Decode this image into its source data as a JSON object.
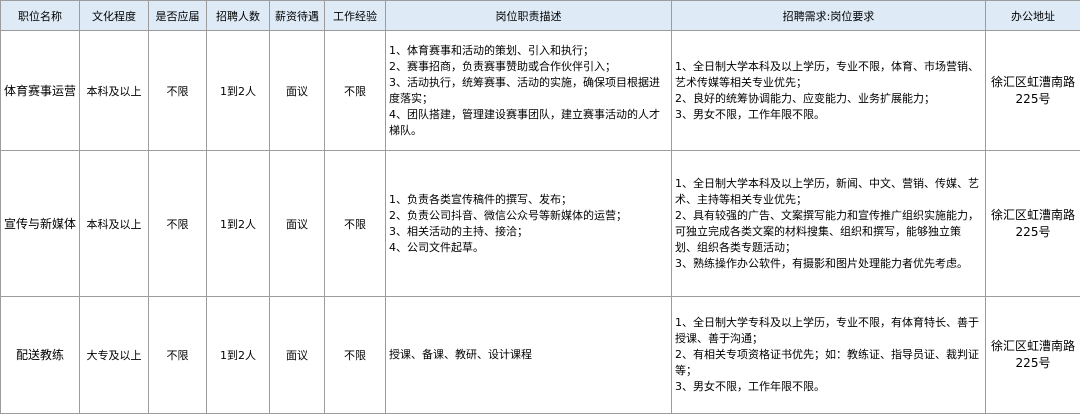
{
  "headers": [
    "职位名称",
    "文化程度",
    "是否应届",
    "招聘人数",
    "薪资待遇",
    "工作经验",
    "岗位职责描述",
    "招聘需求:岗位要求",
    "办公地址"
  ],
  "rows": [
    {
      "title": "体育赛事运营",
      "education": "本科及以上",
      "fresh_grad": "不限",
      "headcount": "1到2人",
      "salary": "面议",
      "experience": "不限",
      "duties": [
        "1、体育赛事和活动的策划、引入和执行；",
        "2、赛事招商，负责赛事赞助或合作伙伴引入；",
        "3、活动执行，统筹赛事、活动的实施，确保项目根据进度落实；",
        "4、团队搭建，管理建设赛事团队，建立赛事活动的人才梯队。"
      ],
      "requirements": [
        "1、全日制大学本科及以上学历，专业不限，体育、市场营销、艺术传媒等相关专业优先；",
        "2、良好的统筹协调能力、应变能力、业务扩展能力；",
        "3、男女不限，工作年限不限。"
      ],
      "address": "徐汇区虹漕南路225号"
    },
    {
      "title": "宣传与新媒体",
      "education": "本科及以上",
      "fresh_grad": "不限",
      "headcount": "1到2人",
      "salary": "面议",
      "experience": "不限",
      "duties": [
        "1、负责各类宣传稿件的撰写、发布；",
        "2、负责公司抖音、微信公众号等新媒体的运营；",
        "3、相关活动的主持、接洽；",
        "4、公司文件起草。"
      ],
      "requirements": [
        "1、全日制大学本科及以上学历，新闻、中文、营销、传媒、艺术、主持等相关专业优先；",
        "2、具有较强的广告、文案撰写能力和宣传推广组织实施能力，可独立完成各类文案的材料搜集、组织和撰写，能够独立策划、组织各类专题活动；",
        "3、熟练操作办公软件，有摄影和图片处理能力者优先考虑。"
      ],
      "address": "徐汇区虹漕南路225号"
    },
    {
      "title": "配送教练",
      "education": "大专及以上",
      "fresh_grad": "不限",
      "headcount": "1到2人",
      "salary": "面议",
      "experience": "不限",
      "duties": [
        "授课、备课、教研、设计课程"
      ],
      "requirements": [
        "1、全日制大学专科及以上学历，专业不限，有体育特长、善于授课、善于沟通；",
        "2、有相关专项资格证书优先；如：教练证、指导员证、裁判证等；",
        "3、男女不限，工作年限不限。"
      ],
      "address": "徐汇区虹漕南路225号"
    }
  ]
}
